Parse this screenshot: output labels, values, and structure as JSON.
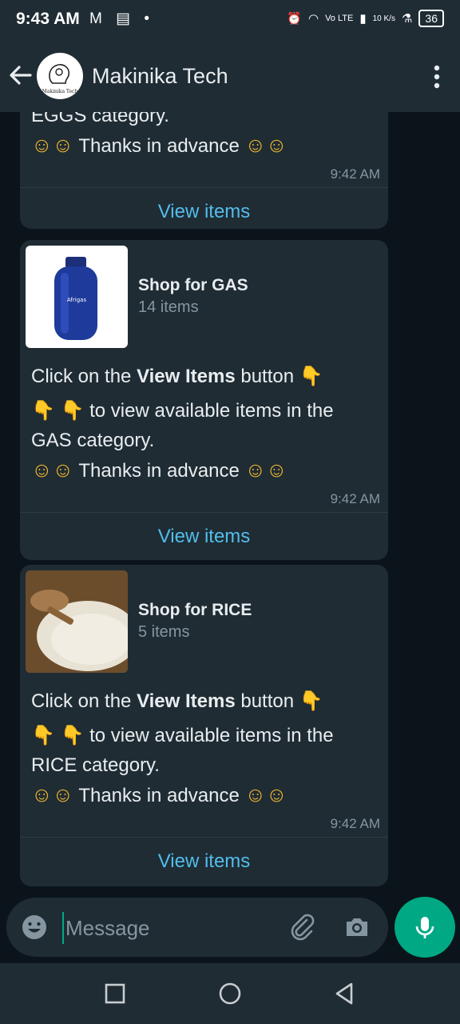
{
  "status_bar": {
    "time": "9:43 AM",
    "left_icons": "M ▤ •",
    "network": "Vo LTE",
    "speed": "10 K/s",
    "battery": "36"
  },
  "header": {
    "contact_name": "Makinika Tech",
    "avatar_text": "Makinika Tech"
  },
  "messages": [
    {
      "partial_text": "EGGS category.",
      "thanks_text": "Thanks in advance",
      "time": "9:42 AM",
      "button_label": "View items"
    },
    {
      "title": "Shop for GAS",
      "count": "14 items",
      "line1_prefix": "Click on the ",
      "line1_bold": "View Items",
      "line1_suffix": " button",
      "line2": "to view available items in the",
      "line3": "GAS category.",
      "thanks_text": "Thanks in advance",
      "time": "9:42 AM",
      "button_label": "View items"
    },
    {
      "title": "Shop for RICE",
      "count": "5 items",
      "line1_prefix": "Click on the ",
      "line1_bold": "View Items",
      "line1_suffix": " button",
      "line2": "to view available items in the",
      "line3": "RICE category.",
      "thanks_text": "Thanks in advance",
      "time": "9:42 AM",
      "button_label": "View items"
    }
  ],
  "emoji": {
    "smile": "☺☺",
    "point_down": "👇"
  },
  "composer": {
    "placeholder": "Message"
  },
  "colors": {
    "background": "#0b141a",
    "bubble": "#1f2c34",
    "accent_link": "#53bdeb",
    "accent_green": "#00a884"
  }
}
